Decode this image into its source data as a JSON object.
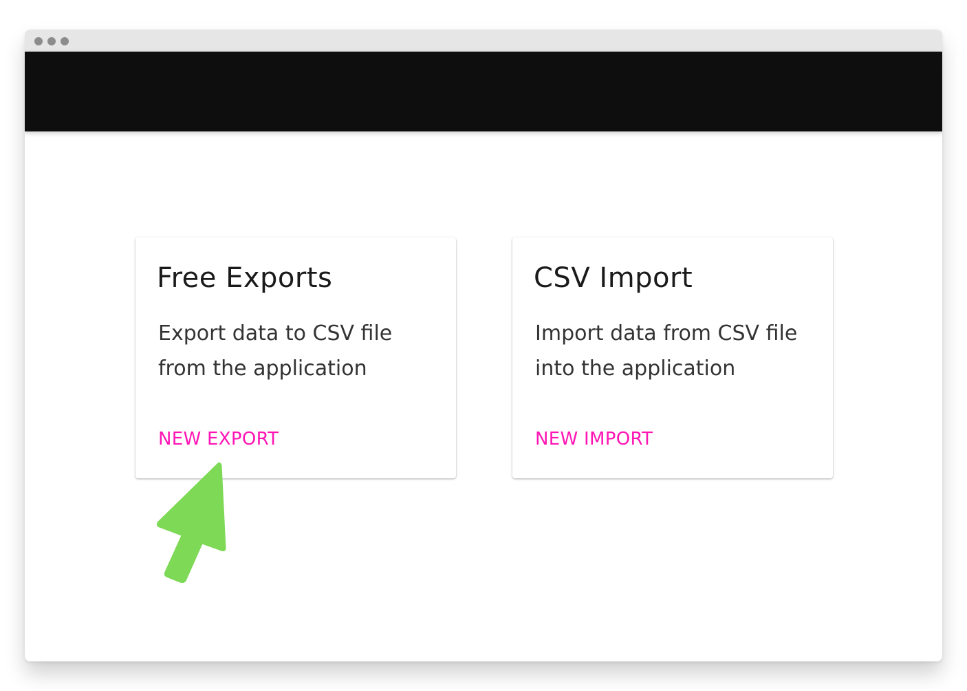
{
  "colors": {
    "window_chrome": "#e6e6e6",
    "traffic_dot": "#8c8c8c",
    "app_bar": "#0e0e0e",
    "accent": "#ff14b4",
    "pointer": "#7ed957"
  },
  "cards": [
    {
      "title": "Free Exports",
      "description": "Export data to CSV file from the application",
      "action_label": "NEW EXPORT"
    },
    {
      "title": "CSV Import",
      "description": "Import data from CSV file into the application",
      "action_label": "NEW IMPORT"
    }
  ],
  "pointer": {
    "icon": "arrow-pointer-icon",
    "target": "NEW EXPORT"
  }
}
